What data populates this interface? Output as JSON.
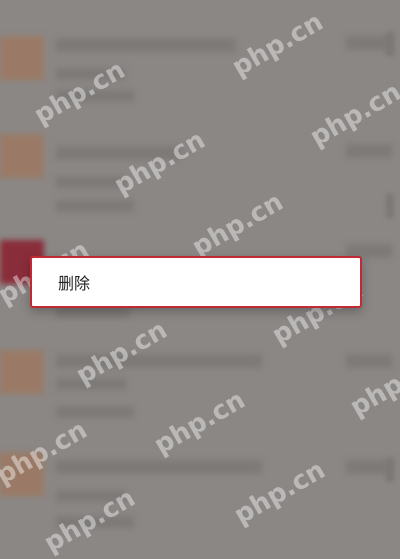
{
  "context_menu": {
    "items": [
      {
        "label": "删除"
      }
    ]
  },
  "watermark": {
    "text": "php.cn"
  },
  "colors": {
    "dim_overlay": "#8b8785",
    "accent_border": "#c02a35",
    "menu_bg": "#ffffff"
  }
}
